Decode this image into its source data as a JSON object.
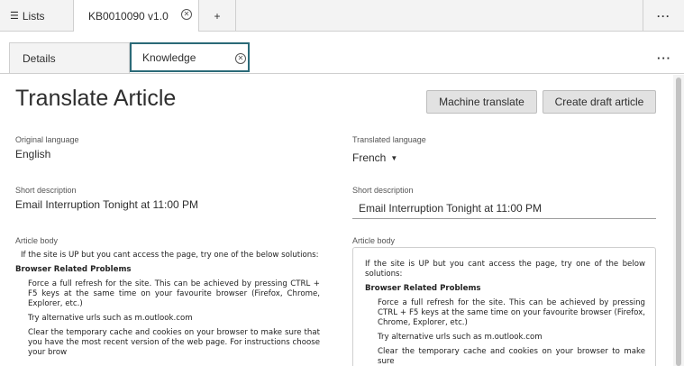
{
  "topbar": {
    "lists_label": "Lists",
    "record_tab_label": "KB0010090 v1.0",
    "more_label": "···"
  },
  "subtabs": {
    "details_label": "Details",
    "knowledge_label": "Knowledge",
    "more_label": "···"
  },
  "page": {
    "title": "Translate Article",
    "machine_translate_label": "Machine translate",
    "create_draft_label": "Create draft article"
  },
  "original": {
    "language_label": "Original language",
    "language_value": "English",
    "short_desc_label": "Short description",
    "short_desc_value": "Email Interruption Tonight at 11:00 PM",
    "body_label": "Article body",
    "body": {
      "intro": "If the site is UP but you cant access the page, try one of the below solutions:",
      "heading": "Browser Related Problems",
      "items": [
        "Force a full refresh for the site. This can be achieved by pressing CTRL + F5 keys at the same time on your favourite browser (Firefox, Chrome, Explorer, etc.)",
        "Try alternative urls such as m.outlook.com",
        "Clear the temporary cache and cookies on your browser to make sure that you have the most recent version of the web page. For instructions choose your brow"
      ]
    }
  },
  "translated": {
    "language_label": "Translated language",
    "language_value": "French",
    "short_desc_label": "Short description",
    "short_desc_value": "Email Interruption Tonight at 11:00 PM",
    "body_label": "Article body",
    "body": {
      "intro": "If the site is UP but you cant access the page, try one of the below solutions:",
      "heading": "Browser Related Problems",
      "items": [
        "Force a full refresh for the site. This can be achieved by pressing CTRL + F5 keys at the same time on your favourite browser (Firefox, Chrome, Explorer, etc.)",
        "Try alternative urls such as m.outlook.com",
        "Clear the temporary cache and cookies on your browser to make sure"
      ]
    }
  }
}
